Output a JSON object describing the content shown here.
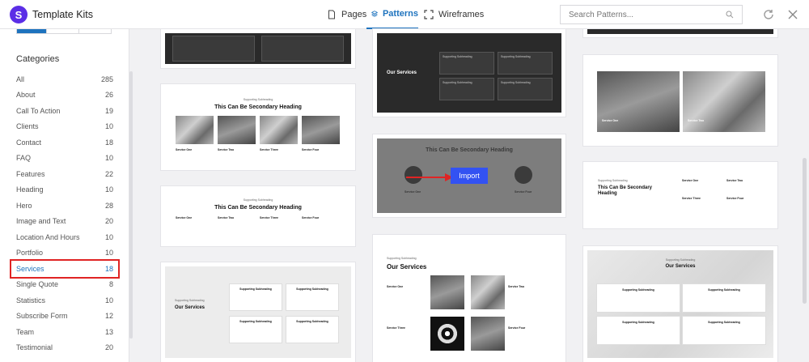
{
  "app": {
    "title": "Template Kits",
    "logo_letter": "S",
    "brand_color": "#5b2ee6",
    "accent_color": "#1e73be",
    "highlight_color": "#e02424"
  },
  "tabs": [
    {
      "label": "Pages",
      "icon": "document-icon",
      "active": false
    },
    {
      "label": "Patterns",
      "icon": "layers-icon",
      "active": true
    },
    {
      "label": "Wireframes",
      "icon": "frame-icon",
      "active": false
    }
  ],
  "search": {
    "placeholder": "Search Patterns..."
  },
  "sidebar": {
    "heading": "Categories",
    "categories": [
      {
        "label": "All",
        "count": "285"
      },
      {
        "label": "About",
        "count": "26"
      },
      {
        "label": "Call To Action",
        "count": "19"
      },
      {
        "label": "Clients",
        "count": "10"
      },
      {
        "label": "Contact",
        "count": "18"
      },
      {
        "label": "FAQ",
        "count": "10"
      },
      {
        "label": "Features",
        "count": "22"
      },
      {
        "label": "Heading",
        "count": "10"
      },
      {
        "label": "Hero",
        "count": "28"
      },
      {
        "label": "Image and Text",
        "count": "20"
      },
      {
        "label": "Location And Hours",
        "count": "10"
      },
      {
        "label": "Portfolio",
        "count": "10"
      },
      {
        "label": "Services",
        "count": "18",
        "active": true
      },
      {
        "label": "Single Quote",
        "count": "8"
      },
      {
        "label": "Statistics",
        "count": "10"
      },
      {
        "label": "Subscribe Form",
        "count": "12"
      },
      {
        "label": "Team",
        "count": "13"
      },
      {
        "label": "Testimonial",
        "count": "20"
      }
    ]
  },
  "cards": {
    "supporting_subheading": "Supporting Subheading",
    "secondary_heading": "This Can Be Secondary Heading",
    "our_services": "Our Services",
    "service_one": "Service One",
    "service_two": "Service Two",
    "service_three": "Service Three",
    "service_four": "Service Four",
    "import_label": "Import"
  }
}
